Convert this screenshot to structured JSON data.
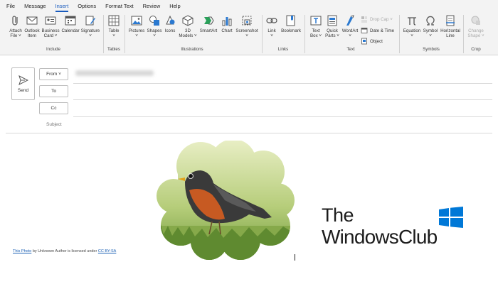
{
  "menu": [
    "File",
    "Message",
    "Insert",
    "Options",
    "Format Text",
    "Review",
    "Help"
  ],
  "ribbon": {
    "include": {
      "label": "Include",
      "attach": [
        "Attach",
        "File ˅"
      ],
      "outlook": [
        "Outlook",
        "Item"
      ],
      "business": [
        "Business",
        "Card ˅"
      ],
      "calendar": [
        "Calendar",
        ""
      ],
      "signature": [
        "Signature",
        "˅"
      ]
    },
    "tables": {
      "label": "Tables",
      "table": [
        "Table",
        "˅"
      ]
    },
    "illustrations": {
      "label": "Illustrations",
      "pictures": [
        "Pictures",
        "˅"
      ],
      "shapes": [
        "Shapes",
        "˅"
      ],
      "icons": [
        "Icons",
        ""
      ],
      "models": [
        "3D",
        "Models ˅"
      ],
      "smartart": [
        "SmartArt",
        ""
      ],
      "chart": [
        "Chart",
        ""
      ],
      "screenshot": [
        "Screenshot",
        "˅"
      ]
    },
    "links": {
      "label": "Links",
      "link": [
        "Link",
        "˅"
      ],
      "bookmark": [
        "Bookmark",
        ""
      ]
    },
    "text": {
      "label": "Text",
      "textbox": [
        "Text",
        "Box ˅"
      ],
      "quickparts": [
        "Quick",
        "Parts ˅"
      ],
      "wordart": [
        "WordArt",
        "˅"
      ],
      "dropcap": "Drop Cap ˅",
      "datetime": "Date & Time",
      "object": "Object"
    },
    "symbols": {
      "label": "Symbols",
      "equation": [
        "Equation",
        "˅"
      ],
      "symbol": [
        "Symbol",
        "˅"
      ],
      "hline": [
        "Horizontal",
        "Line"
      ]
    },
    "crop": {
      "label": "Crop",
      "changeshape": [
        "Change",
        "Shape ˅"
      ]
    }
  },
  "compose": {
    "send": "Send",
    "from": "From ˅",
    "to": "To",
    "cc": "Cc",
    "subject_placeholder": "Subject"
  },
  "body": {
    "credit_link1": "This Photo",
    "credit_mid": " by Unknown Author is licensed under ",
    "credit_link2": "CC BY-SA"
  },
  "watermark": {
    "line1": "The",
    "line2": "WindowsClub"
  },
  "colors": {
    "accent": "#185abd",
    "windows_logo": "#0078d7"
  }
}
